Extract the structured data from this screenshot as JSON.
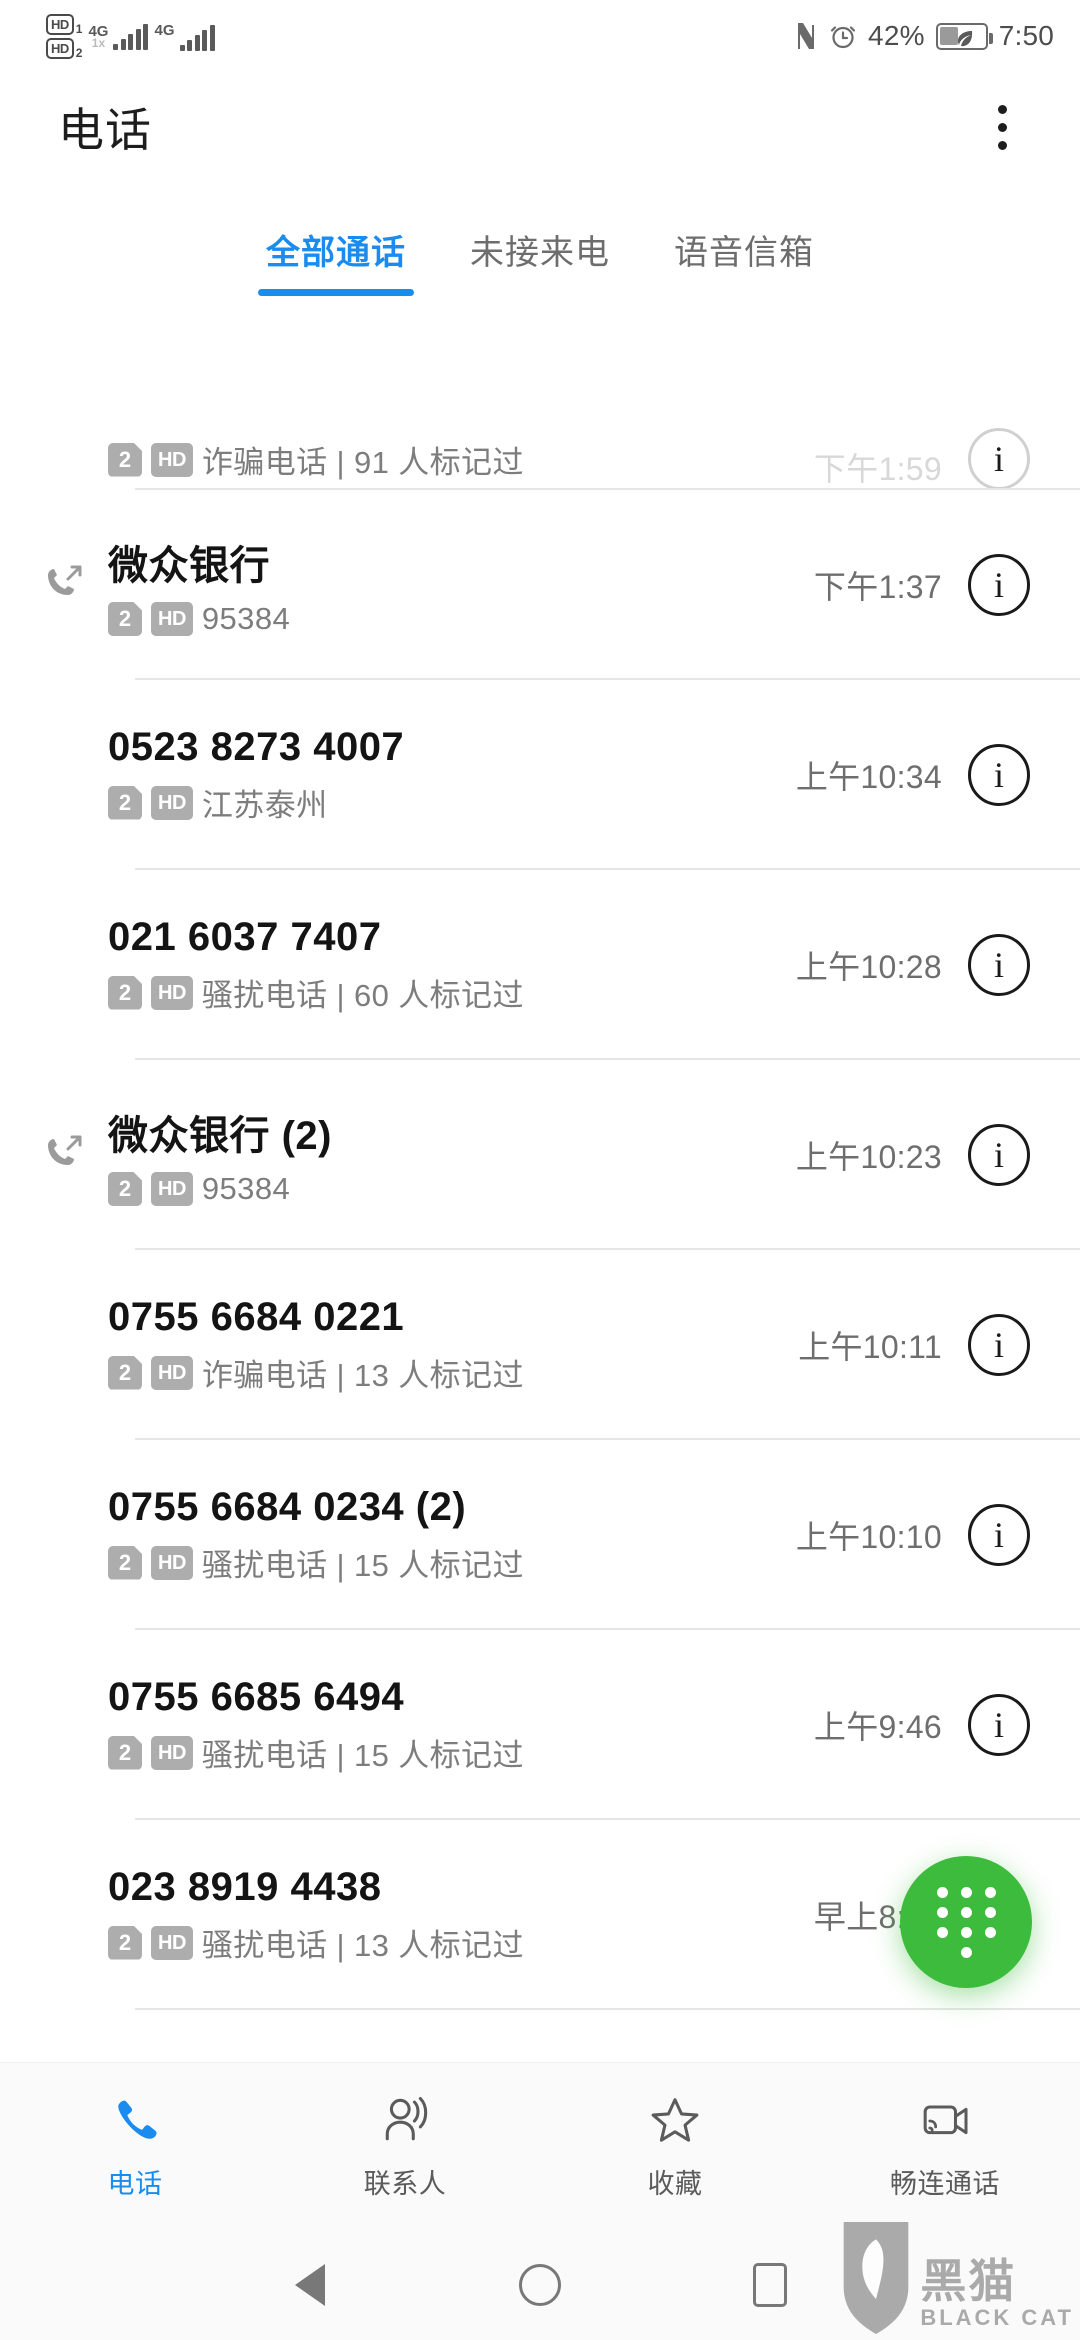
{
  "status_bar": {
    "hd1_label": "HD",
    "hd1_num": "1",
    "hd2_label": "HD",
    "hd2_num": "2",
    "net1": "4G",
    "net1_sub": "1x",
    "net2": "4G",
    "nfc_icon": "nfc-icon",
    "alarm_icon": "alarm-icon",
    "battery_percent": "42%",
    "battery_icon": "battery-saver-icon",
    "clock": "7:50"
  },
  "app_bar": {
    "title": "电话",
    "overflow_icon": "overflow-menu-icon"
  },
  "tabs": [
    {
      "label": "全部通话",
      "active": true
    },
    {
      "label": "未接来电",
      "active": false
    },
    {
      "label": "语音信箱",
      "active": false
    }
  ],
  "accent_color": "#1a8cf0",
  "fab": {
    "icon": "dialpad-icon",
    "color": "#3cbb3c"
  },
  "call_log": [
    {
      "title": "",
      "call_type": "none",
      "sim": "2",
      "hd": "HD",
      "subtitle": "诈骗电话 | 91 人标记过",
      "time": "下午1:59",
      "clipped": true
    },
    {
      "title": "微众银行",
      "call_type": "outgoing",
      "sim": "2",
      "hd": "HD",
      "subtitle": "95384",
      "time": "下午1:37",
      "clipped": false
    },
    {
      "title": "0523 8273 4007",
      "call_type": "none",
      "sim": "2",
      "hd": "HD",
      "subtitle": "江苏泰州",
      "time": "上午10:34",
      "clipped": false
    },
    {
      "title": "021 6037 7407",
      "call_type": "none",
      "sim": "2",
      "hd": "HD",
      "subtitle": "骚扰电话 | 60 人标记过",
      "time": "上午10:28",
      "clipped": false
    },
    {
      "title": "微众银行 (2)",
      "call_type": "outgoing",
      "sim": "2",
      "hd": "HD",
      "subtitle": "95384",
      "time": "上午10:23",
      "clipped": false
    },
    {
      "title": "0755 6684 0221",
      "call_type": "none",
      "sim": "2",
      "hd": "HD",
      "subtitle": "诈骗电话 | 13 人标记过",
      "time": "上午10:11",
      "clipped": false
    },
    {
      "title": "0755 6684 0234 (2)",
      "call_type": "none",
      "sim": "2",
      "hd": "HD",
      "subtitle": "骚扰电话 | 15 人标记过",
      "time": "上午10:10",
      "clipped": false
    },
    {
      "title": "0755 6685 6494",
      "call_type": "none",
      "sim": "2",
      "hd": "HD",
      "subtitle": "骚扰电话 | 15 人标记过",
      "time": "上午9:46",
      "clipped": false
    },
    {
      "title": "023 8919 4438",
      "call_type": "none",
      "sim": "2",
      "hd": "HD",
      "subtitle": "骚扰电话 | 13 人标记过",
      "time": "早上8:33",
      "clipped": false
    }
  ],
  "info_glyph": "i",
  "bottom_nav": [
    {
      "label": "电话",
      "icon": "phone-icon",
      "active": true
    },
    {
      "label": "联系人",
      "icon": "contacts-icon",
      "active": false
    },
    {
      "label": "收藏",
      "icon": "star-icon",
      "active": false
    },
    {
      "label": "畅连通话",
      "icon": "video-call-icon",
      "active": false
    }
  ],
  "system_nav": {
    "back_icon": "back-triangle-icon",
    "home_icon": "home-circle-icon",
    "recents_icon": "recents-square-icon"
  },
  "watermark": {
    "cn": "黑猫",
    "en": "BLACK CAT"
  }
}
